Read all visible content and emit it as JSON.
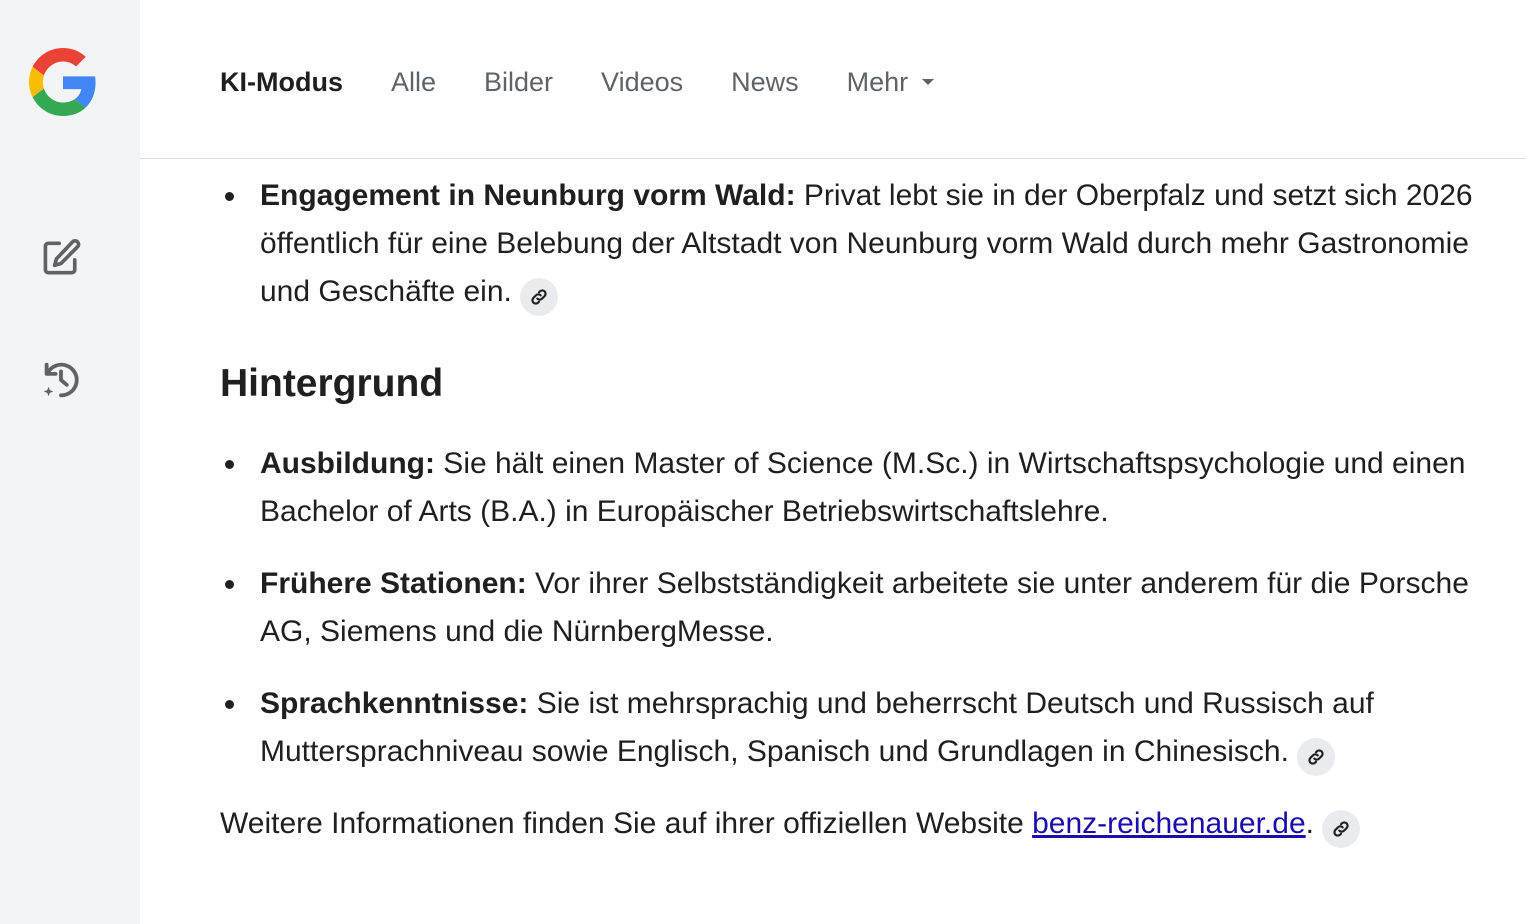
{
  "tabs": [
    {
      "label": "KI-Modus"
    },
    {
      "label": "Alle"
    },
    {
      "label": "Bilder"
    },
    {
      "label": "Videos"
    },
    {
      "label": "News"
    },
    {
      "label": "Mehr"
    }
  ],
  "sidebar": {
    "logo": "google-g-logo",
    "icons": [
      "new-chat-icon",
      "history-icon"
    ]
  },
  "content": {
    "intro_item": {
      "bold": "Engagement in Neunburg vorm Wald:",
      "text": " Privat lebt sie in der Oberpfalz und setzt sich 2026 öffentlich für eine Belebung der Altstadt von Neunburg vorm Wald durch mehr Gastronomie und Geschäfte ein."
    },
    "heading": "Hintergrund",
    "items": [
      {
        "bold": "Ausbildung:",
        "text": " Sie hält einen Master of Science (M.Sc.) in Wirtschaftspsychologie und einen Bachelor of Arts (B.A.) in Europäischer Betriebswirtschaftslehre."
      },
      {
        "bold": "Frühere Stationen:",
        "text": " Vor ihrer Selbstständigkeit arbeitete sie unter anderem für die Porsche AG, Siemens und die NürnbergMesse."
      },
      {
        "bold": "Sprachkenntnisse:",
        "text": " Sie ist mehrsprachig und beherrscht Deutsch und Russisch auf Muttersprachniveau sowie Englisch, Spanisch und Grundlagen in Chinesisch."
      }
    ],
    "footer": {
      "text": "Weitere Informationen finden Sie auf ihrer offiziellen Website ",
      "link": "benz-reichenauer.de",
      "suffix": "."
    }
  },
  "colors": {
    "sidebar_bg": "#f3f4f6",
    "link": "#1a0dab",
    "cite_bg": "#e9ebee"
  }
}
